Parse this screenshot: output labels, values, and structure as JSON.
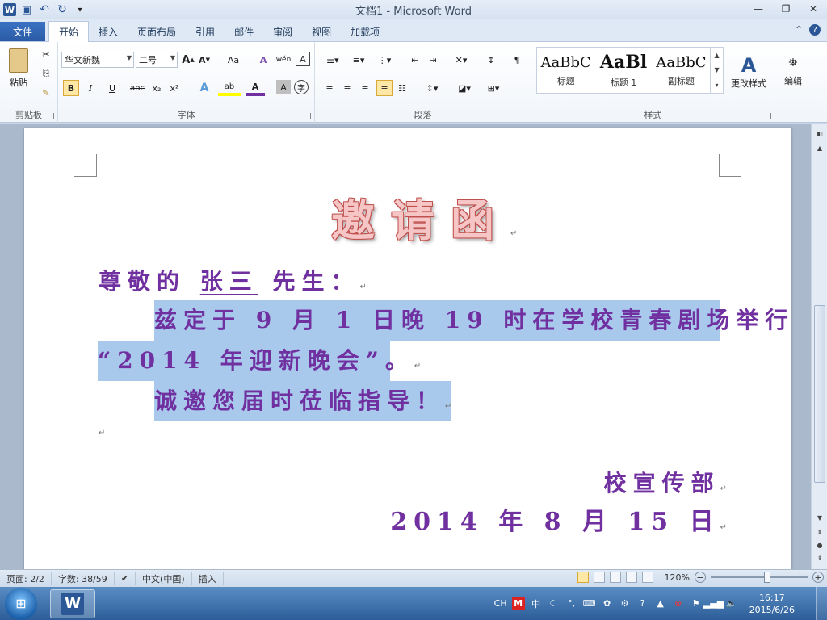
{
  "window": {
    "title": "文档1 - Microsoft Word",
    "app_icon": "W",
    "min_icon": "—",
    "max_icon": "❐",
    "close_icon": "✕"
  },
  "qat": {
    "save_icon": "💾",
    "undo_icon": "↶",
    "redo_icon": "↻",
    "customize_icon": "▾"
  },
  "tabs": [
    {
      "label": "文件"
    },
    {
      "label": "开始"
    },
    {
      "label": "插入"
    },
    {
      "label": "页面布局"
    },
    {
      "label": "引用"
    },
    {
      "label": "邮件"
    },
    {
      "label": "审阅"
    },
    {
      "label": "视图"
    },
    {
      "label": "加载项"
    }
  ],
  "tabs_right": {
    "minimize_ribbon": "⌃",
    "help": "?"
  },
  "ribbon": {
    "clipboard": {
      "label": "剪贴板",
      "paste": "粘贴",
      "cut_icon": "✂",
      "copy_icon": "⎘",
      "format_painter_icon": "🖌"
    },
    "font": {
      "label": "字体",
      "font_name": "华文新魏",
      "font_size": "二号",
      "grow": "A",
      "shrink": "A",
      "change_case": "Aa",
      "clear": "A",
      "phonetic": "wén",
      "char_border": "A",
      "bold": "B",
      "italic": "I",
      "underline": "U",
      "strike": "abc",
      "subscript": "x₂",
      "superscript": "x²",
      "effects": "A",
      "highlight": "ab",
      "color": "A",
      "shading": "A",
      "enclose": "字"
    },
    "paragraph": {
      "label": "段落"
    },
    "styles": {
      "label": "样式",
      "items": [
        {
          "sample": "AaBbC",
          "name": "标题"
        },
        {
          "sample": "AaBl",
          "name": "标题 1"
        },
        {
          "sample": "AaBbC",
          "name": "副标题"
        }
      ],
      "change_styles": "更改样式"
    },
    "editing": {
      "label": "编辑"
    }
  },
  "document": {
    "title": "邀请函",
    "salutation_prefix": "尊敬的 ",
    "name": "张三",
    "salutation_suffix": " 先生：",
    "body_line1": "兹定于 9 月 1 日晚 19 时在学校青春剧场举行",
    "body_line2": "“2014 年迎新晚会”。",
    "body_line3": "诚邀您届时莅临指导！",
    "signature": "校宣传部",
    "date": "2014 年 8 月 15 日",
    "para_mark": "↵"
  },
  "statusbar": {
    "page": "页面: 2/2",
    "words": "字数: 38/59",
    "language": "中文(中国)",
    "mode": "插入",
    "zoom": "120%",
    "zoom_out": "−",
    "zoom_in": "+"
  },
  "taskbar": {
    "ime": "CH",
    "time": "16:17",
    "date": "2015/6/26"
  },
  "colors": {
    "accent": "#2b5797",
    "doc_text": "#7030a0",
    "title_fill": "#f6c6c6",
    "title_outline": "#c0504d",
    "selection": "#a8c8ec"
  }
}
